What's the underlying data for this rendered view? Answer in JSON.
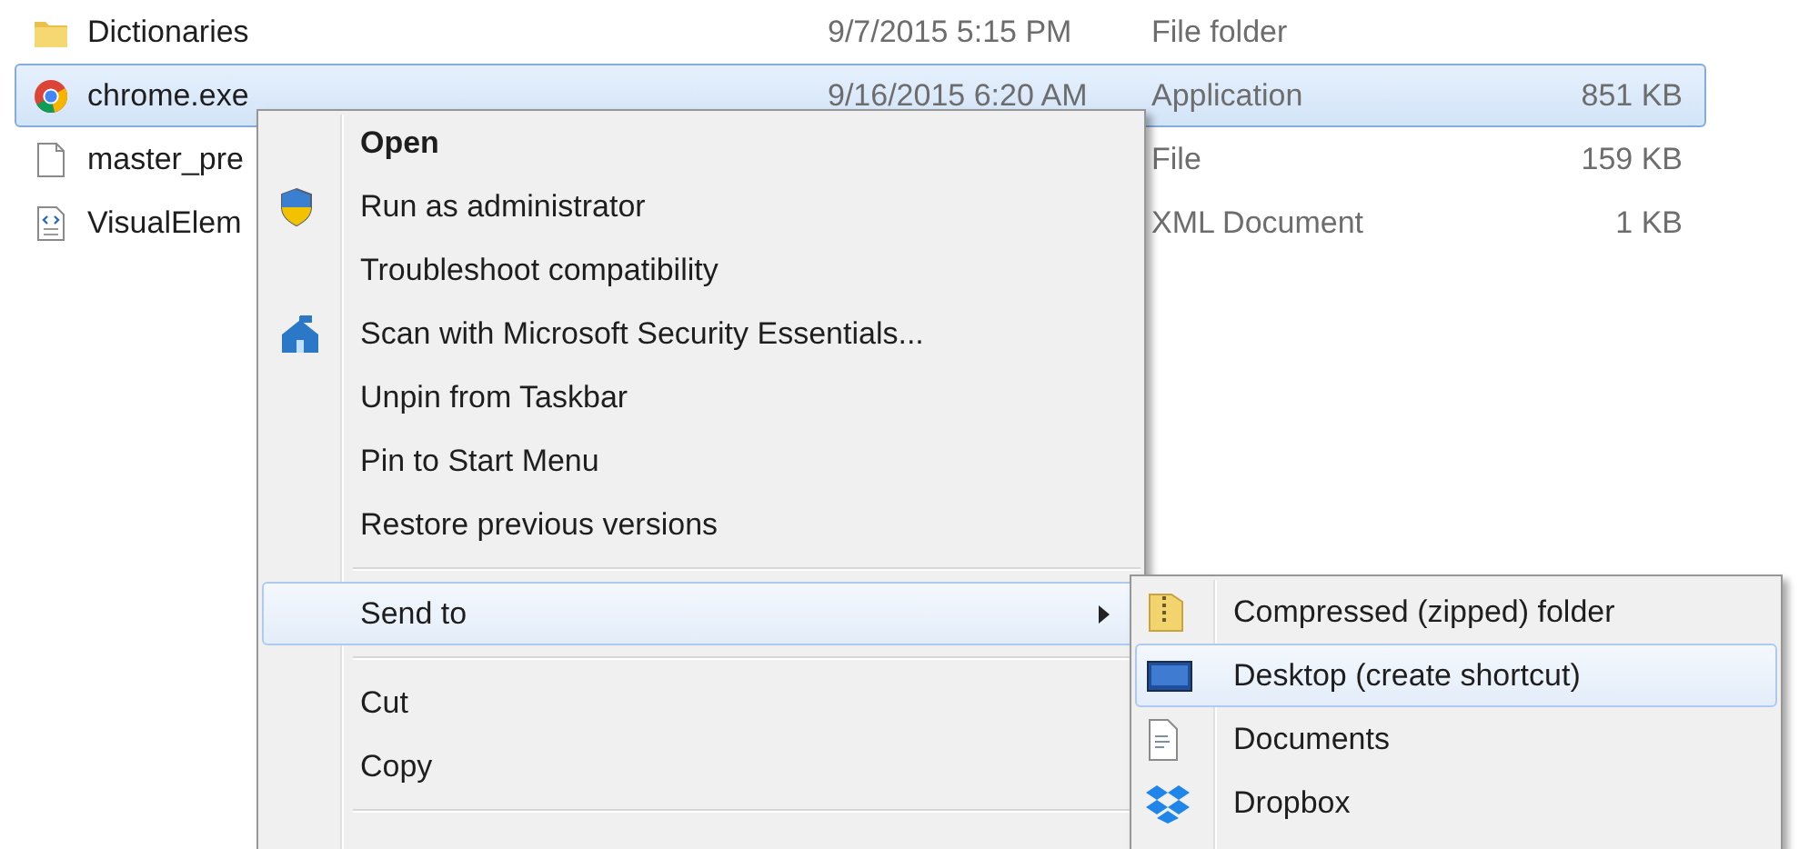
{
  "files": [
    {
      "name": "Dictionaries",
      "date": "9/7/2015 5:15 PM",
      "type": "File folder",
      "selected": false
    },
    {
      "name": "chrome.exe",
      "date": "9/16/2015 6:20 AM",
      "type": "Application",
      "size": "851 KB",
      "selected": true
    },
    {
      "name": "master_pre",
      "type": "File",
      "size": "159 KB",
      "selected": false
    },
    {
      "name": "VisualElem",
      "type": "XML Document",
      "size": "1 KB",
      "selected": false
    }
  ],
  "context_menu": {
    "items": [
      {
        "kind": "item",
        "label": "Open",
        "default": true,
        "selected": false
      },
      {
        "kind": "item",
        "label": "Run as administrator",
        "default": false,
        "selected": false
      },
      {
        "kind": "item",
        "label": "Troubleshoot compatibility",
        "default": false,
        "selected": false
      },
      {
        "kind": "item",
        "label": "Scan with Microsoft Security Essentials...",
        "default": false,
        "selected": false
      },
      {
        "kind": "item",
        "label": "Unpin from Taskbar",
        "default": false,
        "selected": false
      },
      {
        "kind": "item",
        "label": "Pin to Start Menu",
        "default": false,
        "selected": false
      },
      {
        "kind": "item",
        "label": "Restore previous versions",
        "default": false,
        "selected": false
      },
      {
        "kind": "separator"
      },
      {
        "kind": "item",
        "label": "Send to",
        "default": false,
        "selected": true,
        "submenu": true
      },
      {
        "kind": "separator"
      },
      {
        "kind": "item",
        "label": "Cut",
        "default": false,
        "selected": false
      },
      {
        "kind": "item",
        "label": "Copy",
        "default": false,
        "selected": false
      },
      {
        "kind": "separator"
      }
    ]
  },
  "send_to_menu": {
    "items": [
      {
        "label": "Compressed (zipped) folder",
        "selected": false
      },
      {
        "label": "Desktop (create shortcut)",
        "selected": true
      },
      {
        "label": "Documents",
        "selected": false
      },
      {
        "label": "Dropbox",
        "selected": false
      }
    ]
  }
}
